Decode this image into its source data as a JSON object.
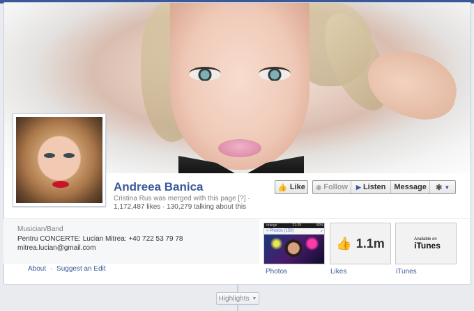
{
  "page": {
    "name": "Andreea Banica",
    "merge_notice": "Cristina Rus was merged with this page [?] ·",
    "stats": "1,172,487 likes · 130,279 talking about this"
  },
  "actions": {
    "like_label": "Like",
    "follow_label": "Follow",
    "listen_label": "Listen",
    "message_label": "Message"
  },
  "about": {
    "category": "Musician/Band",
    "concert": "Pentru CONCERTE: Lucian Mitrea: +40 722 53 79 78",
    "email": "mitrea.lucian@gmail.com",
    "about_link": "About",
    "separator": "·",
    "suggest_link": "Suggest an Edit"
  },
  "apps": {
    "photos": {
      "label": "Photos",
      "status_left": "orange",
      "status_time": "21:29",
      "status_right": "80%",
      "nav_back": "< Photos (150)",
      "nav_icon": "✓"
    },
    "likes": {
      "label": "Likes",
      "value": "1.1m"
    },
    "itunes": {
      "label": "iTunes",
      "badge_small": "Available on",
      "badge_big": "iTunes"
    }
  },
  "highlights": {
    "label": "Highlights"
  },
  "icons": {
    "like": "thumbs-up-icon",
    "follow": "rss-icon",
    "listen": "play-icon",
    "settings": "gear-icon",
    "dropdown": "chevron-down-icon",
    "apple": "apple-icon"
  },
  "colors": {
    "brand": "#3b5998",
    "lipstick": "#c8142a"
  }
}
